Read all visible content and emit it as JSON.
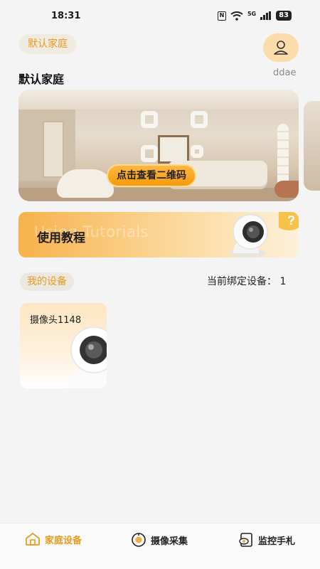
{
  "status_bar": {
    "time": "18:31",
    "network": "5G",
    "battery": "83",
    "nfc": "N"
  },
  "header": {
    "family_chip": "默认家庭",
    "family_title": "默认家庭",
    "username": "ddae"
  },
  "banner": {
    "qr_button": "点击查看二维码"
  },
  "tutorial": {
    "title": "使用教程",
    "watermark": "Using Tutorials"
  },
  "devices": {
    "section_label": "我的设备",
    "bound_count_text": "当前绑定设备：  1",
    "items": [
      {
        "name": "摄像头1148"
      }
    ]
  },
  "tabbar": {
    "items": [
      {
        "label": "家庭设备",
        "icon": "home-icon",
        "active": true
      },
      {
        "label": "摄像采集",
        "icon": "capture-icon",
        "active": false
      },
      {
        "label": "监控手札",
        "icon": "monitor-notes-icon",
        "active": false
      }
    ]
  },
  "colors": {
    "accent": "#e89a1e",
    "avatar_bg": "#fbdcaa",
    "background": "#f4f4f4"
  }
}
